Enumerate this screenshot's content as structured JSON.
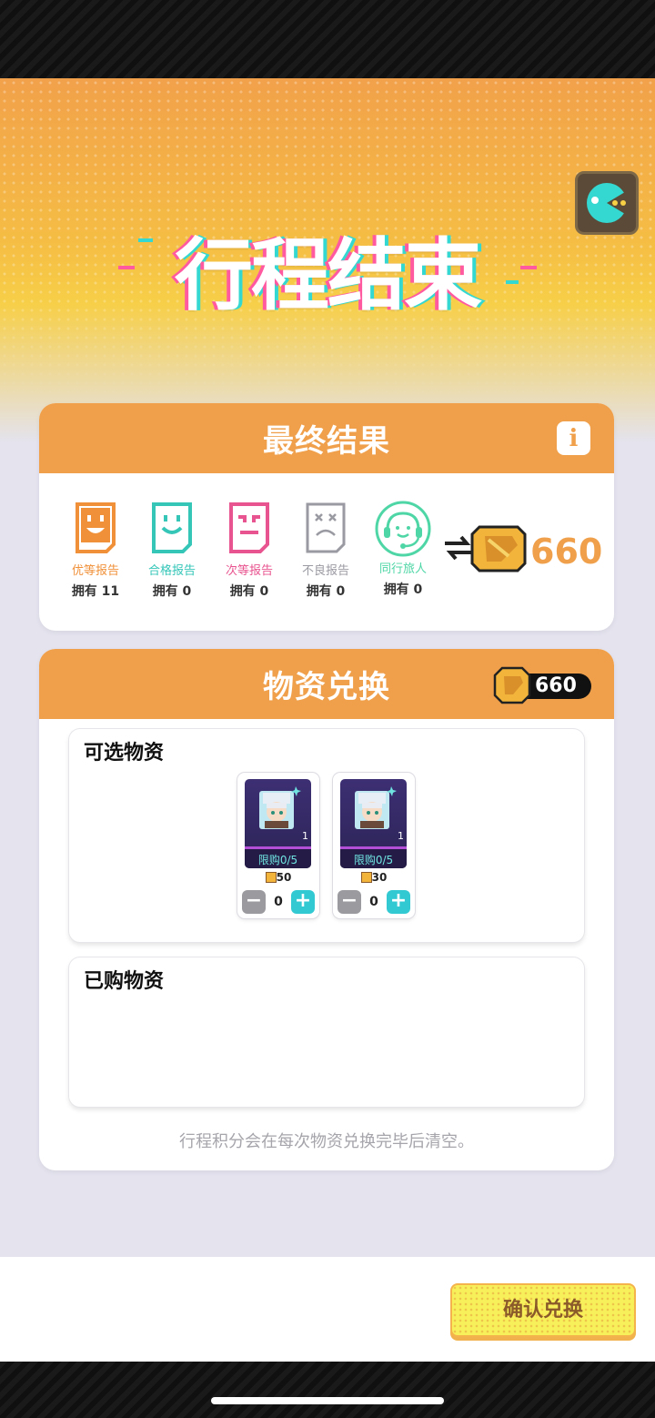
{
  "hero": {
    "title": "行程结束"
  },
  "assistant": {
    "icon": "chat-assistant-icon"
  },
  "final_result": {
    "title": "最终结果",
    "info_label": "i",
    "reports": [
      {
        "name": "优等报告",
        "owned": "拥有 11",
        "color": "#f0913a",
        "icon": "happy-report-icon"
      },
      {
        "name": "合格报告",
        "owned": "拥有 0",
        "color": "#35c6b8",
        "icon": "smile-report-icon"
      },
      {
        "name": "次等报告",
        "owned": "拥有 0",
        "color": "#e8548f",
        "icon": "displeased-report-icon"
      },
      {
        "name": "不良报告",
        "owned": "拥有 0",
        "color": "#9a9aa2",
        "icon": "bad-report-icon"
      },
      {
        "name": "同行旅人",
        "owned": "拥有 0",
        "color": "#4fd6a6",
        "icon": "headset-traveler-icon"
      }
    ],
    "total_points": "660"
  },
  "exchange": {
    "title": "物资兑换",
    "balance": "660",
    "available_title": "可选物资",
    "items": [
      {
        "limit": "限购0/5",
        "qty": "1",
        "price": "50",
        "count": "0"
      },
      {
        "limit": "限购0/5",
        "qty": "1",
        "price": "30",
        "count": "0"
      }
    ],
    "purchased_title": "已购物资",
    "note": "行程积分会在每次物资兑换完毕后清空。"
  },
  "footer": {
    "confirm_label": "确认兑换"
  },
  "colors": {
    "accent": "#f0a04b",
    "coin": "#f2b43a",
    "plus": "#33c9d2"
  }
}
